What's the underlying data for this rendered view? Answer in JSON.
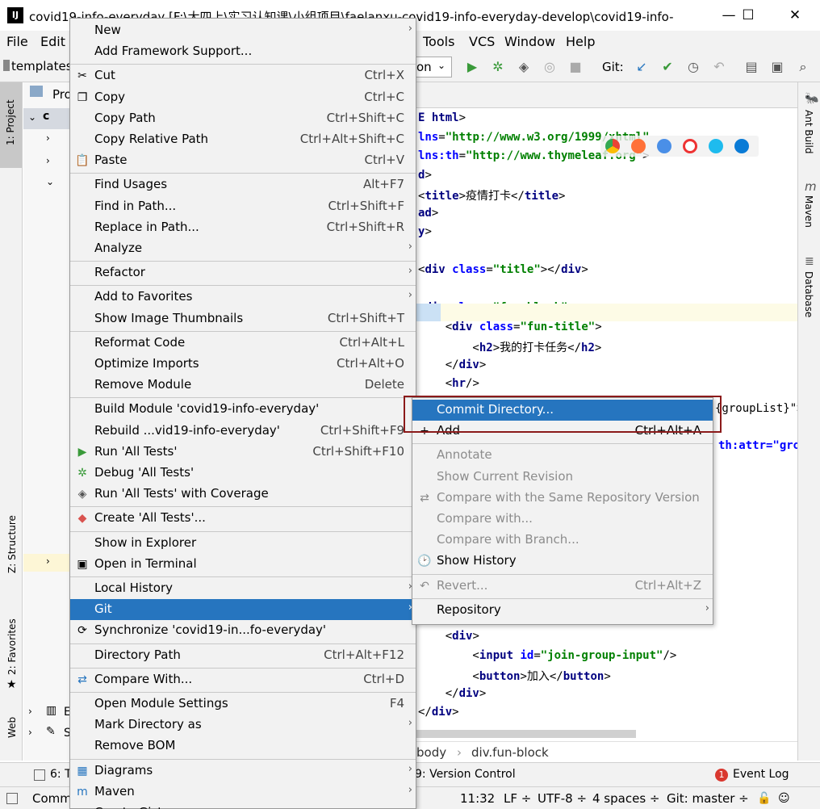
{
  "window": {
    "title": "covid19-info-everyday [F:\\大四上\\实习认知课\\小组项目\\faelanxu-covid19-info-everyday-develop\\covid19-info-...",
    "minimize": "—",
    "maximize": "☐",
    "close": "✕"
  },
  "menubar": {
    "file": "File",
    "edit": "Edit",
    "tools": "Tools",
    "vcs": "VCS",
    "window": "Window",
    "help": "Help"
  },
  "toolbar": {
    "breadcrumb": "templates",
    "run_config": "on",
    "git_label": "Git:"
  },
  "left_strip": {
    "project": "1: Project",
    "structure": "Z: Structure",
    "favorites": "2: Favorites",
    "web": "Web"
  },
  "right_strip": {
    "ant_build": "Ant Build",
    "maven": "Maven",
    "database": "Database"
  },
  "project_panel": {
    "tab": "Pro",
    "items": [
      "c",
      "E",
      "S"
    ]
  },
  "editor": {
    "lines": [
      {
        "parts": [
          [
            "tag",
            "E html"
          ],
          [
            "plain",
            ">"
          ]
        ]
      },
      {
        "parts": [
          [
            "attr",
            "lns"
          ],
          [
            "plain",
            "="
          ],
          [
            "str",
            "\"http://www.w3.org/1999/xhtml\""
          ]
        ]
      },
      {
        "parts": [
          [
            "attr",
            "lns:th"
          ],
          [
            "plain",
            "="
          ],
          [
            "str",
            "\"http://www.thymeleaf.org\""
          ],
          [
            "plain",
            ">"
          ]
        ]
      },
      {
        "parts": [
          [
            "tag",
            "d"
          ],
          [
            "plain",
            ">"
          ]
        ]
      },
      {
        "parts": [
          [
            "plain",
            "<"
          ],
          [
            "tag",
            "title"
          ],
          [
            "plain",
            ">疫情打卡</"
          ],
          [
            "tag",
            "title"
          ],
          [
            "plain",
            ">"
          ]
        ]
      },
      {
        "parts": [
          [
            "tag",
            "ad"
          ],
          [
            "plain",
            ">"
          ]
        ]
      },
      {
        "parts": [
          [
            "tag",
            "y"
          ],
          [
            "plain",
            ">"
          ]
        ]
      },
      {
        "parts": []
      },
      {
        "parts": [
          [
            "plain",
            "<"
          ],
          [
            "tag",
            "div"
          ],
          [
            "plain",
            " "
          ],
          [
            "attr",
            "class"
          ],
          [
            "plain",
            "="
          ],
          [
            "str",
            "\"title\""
          ],
          [
            "plain",
            "></"
          ],
          [
            "tag",
            "div"
          ],
          [
            "plain",
            ">"
          ]
        ]
      },
      {
        "parts": []
      },
      {
        "parts": [
          [
            "plain",
            "<"
          ],
          [
            "tag",
            "div"
          ],
          [
            "plain",
            " "
          ],
          [
            "attr",
            "class"
          ],
          [
            "plain",
            "="
          ],
          [
            "str",
            "\"fun-block\""
          ],
          [
            "plain",
            ">"
          ]
        ]
      },
      {
        "parts": [
          [
            "plain",
            "    <"
          ],
          [
            "tag",
            "div"
          ],
          [
            "plain",
            " "
          ],
          [
            "attr",
            "class"
          ],
          [
            "plain",
            "="
          ],
          [
            "str",
            "\"fun-title\""
          ],
          [
            "plain",
            ">"
          ]
        ]
      },
      {
        "parts": [
          [
            "plain",
            "        <"
          ],
          [
            "tag",
            "h2"
          ],
          [
            "plain",
            ">我的打卡任务</"
          ],
          [
            "tag",
            "h2"
          ],
          [
            "plain",
            ">"
          ]
        ]
      },
      {
        "parts": [
          [
            "plain",
            "    </"
          ],
          [
            "tag",
            "div"
          ],
          [
            "plain",
            ">"
          ]
        ]
      },
      {
        "parts": [
          [
            "plain",
            "    <"
          ],
          [
            "tag",
            "hr"
          ],
          [
            "plain",
            "/>"
          ]
        ]
      }
    ],
    "line_after_submenu_1": "{groupList}\">",
    "line_after_submenu_2": "th:attr=\"grou",
    "lines_bottom": [
      {
        "parts": [
          [
            "plain",
            "    <"
          ],
          [
            "tag",
            "div"
          ],
          [
            "plain",
            ">"
          ]
        ]
      },
      {
        "parts": [
          [
            "plain",
            "        <"
          ],
          [
            "tag",
            "input"
          ],
          [
            "plain",
            " "
          ],
          [
            "attr",
            "id"
          ],
          [
            "plain",
            "="
          ],
          [
            "str",
            "\"join-group-input\""
          ],
          [
            "plain",
            "/>"
          ]
        ]
      },
      {
        "parts": [
          [
            "plain",
            "        <"
          ],
          [
            "tag",
            "button"
          ],
          [
            "plain",
            ">加入</"
          ],
          [
            "tag",
            "button"
          ],
          [
            "plain",
            ">"
          ]
        ]
      },
      {
        "parts": [
          [
            "plain",
            "    </"
          ],
          [
            "tag",
            "div"
          ],
          [
            "plain",
            ">"
          ]
        ]
      },
      {
        "parts": [
          [
            "plain",
            "</"
          ],
          [
            "tag",
            "div"
          ],
          [
            "plain",
            ">"
          ]
        ]
      }
    ],
    "breadcrumb_1": "body",
    "breadcrumb_2": "div.fun-block"
  },
  "bottom_bar": {
    "todo": "6: T",
    "version_control": "9: Version Control",
    "event_log": "Event Log",
    "event_badge": "1"
  },
  "status_bar": {
    "left": "Comm",
    "position": "11:32",
    "line_sep": "LF ÷",
    "encoding": "UTF-8 ÷",
    "indent": "4 spaces ÷",
    "git": "Git: master ÷"
  },
  "context_menu": {
    "items": [
      {
        "label": "New",
        "shortcut": "",
        "submenu": true,
        "icon": ""
      },
      {
        "label": "Add Framework Support...",
        "shortcut": "",
        "submenu": false,
        "icon": ""
      },
      {
        "sep": true
      },
      {
        "label": "Cut",
        "shortcut": "Ctrl+X",
        "submenu": false,
        "icon": "✂"
      },
      {
        "label": "Copy",
        "shortcut": "Ctrl+C",
        "submenu": false,
        "icon": "❐"
      },
      {
        "label": "Copy Path",
        "shortcut": "Ctrl+Shift+C",
        "submenu": false,
        "icon": ""
      },
      {
        "label": "Copy Relative Path",
        "shortcut": "Ctrl+Alt+Shift+C",
        "submenu": false,
        "icon": ""
      },
      {
        "label": "Paste",
        "shortcut": "Ctrl+V",
        "submenu": false,
        "icon": "📋"
      },
      {
        "sep": true
      },
      {
        "label": "Find Usages",
        "shortcut": "Alt+F7",
        "submenu": false,
        "icon": ""
      },
      {
        "label": "Find in Path...",
        "shortcut": "Ctrl+Shift+F",
        "submenu": false,
        "icon": ""
      },
      {
        "label": "Replace in Path...",
        "shortcut": "Ctrl+Shift+R",
        "submenu": false,
        "icon": ""
      },
      {
        "label": "Analyze",
        "shortcut": "",
        "submenu": true,
        "icon": ""
      },
      {
        "sep": true
      },
      {
        "label": "Refactor",
        "shortcut": "",
        "submenu": true,
        "icon": ""
      },
      {
        "sep": true
      },
      {
        "label": "Add to Favorites",
        "shortcut": "",
        "submenu": true,
        "icon": ""
      },
      {
        "label": "Show Image Thumbnails",
        "shortcut": "Ctrl+Shift+T",
        "submenu": false,
        "icon": ""
      },
      {
        "sep": true
      },
      {
        "label": "Reformat Code",
        "shortcut": "Ctrl+Alt+L",
        "submenu": false,
        "icon": ""
      },
      {
        "label": "Optimize Imports",
        "shortcut": "Ctrl+Alt+O",
        "submenu": false,
        "icon": ""
      },
      {
        "label": "Remove Module",
        "shortcut": "Delete",
        "submenu": false,
        "icon": ""
      },
      {
        "sep": true
      },
      {
        "label": "Build Module 'covid19-info-everyday'",
        "shortcut": "",
        "submenu": false,
        "icon": ""
      },
      {
        "label": "Rebuild ...vid19-info-everyday'",
        "shortcut": "Ctrl+Shift+F9",
        "submenu": false,
        "icon": ""
      },
      {
        "label": "Run 'All Tests'",
        "shortcut": "Ctrl+Shift+F10",
        "submenu": false,
        "icon": "▶",
        "iconColor": "#3a9a3a"
      },
      {
        "label": "Debug 'All Tests'",
        "shortcut": "",
        "submenu": false,
        "icon": "✲",
        "iconColor": "#3a9a3a"
      },
      {
        "label": "Run 'All Tests' with Coverage",
        "shortcut": "",
        "submenu": false,
        "icon": "◈",
        "iconColor": "#555"
      },
      {
        "sep": true
      },
      {
        "label": "Create 'All Tests'...",
        "shortcut": "",
        "submenu": false,
        "icon": "◆",
        "iconColor": "#d9534f"
      },
      {
        "sep": true
      },
      {
        "label": "Show in Explorer",
        "shortcut": "",
        "submenu": false,
        "icon": ""
      },
      {
        "label": "Open in Terminal",
        "shortcut": "",
        "submenu": false,
        "icon": "▣"
      },
      {
        "sep": true
      },
      {
        "label": "Local History",
        "shortcut": "",
        "submenu": true,
        "icon": ""
      },
      {
        "label": "Git",
        "shortcut": "",
        "submenu": true,
        "icon": "",
        "selected": true
      },
      {
        "label": "Synchronize 'covid19-in...fo-everyday'",
        "shortcut": "",
        "submenu": false,
        "icon": "⟳"
      },
      {
        "sep": true
      },
      {
        "label": "Directory Path",
        "shortcut": "Ctrl+Alt+F12",
        "submenu": false,
        "icon": ""
      },
      {
        "sep": true
      },
      {
        "label": "Compare With...",
        "shortcut": "Ctrl+D",
        "submenu": false,
        "icon": "⇄",
        "iconColor": "#2675bf"
      },
      {
        "sep": true
      },
      {
        "label": "Open Module Settings",
        "shortcut": "F4",
        "submenu": false,
        "icon": ""
      },
      {
        "label": "Mark Directory as",
        "shortcut": "",
        "submenu": true,
        "icon": ""
      },
      {
        "label": "Remove BOM",
        "shortcut": "",
        "submenu": false,
        "icon": ""
      },
      {
        "sep": true
      },
      {
        "label": "Diagrams",
        "shortcut": "",
        "submenu": true,
        "icon": "▦",
        "iconColor": "#2675bf"
      },
      {
        "label": "Maven",
        "shortcut": "",
        "submenu": true,
        "icon": "m",
        "iconColor": "#2675bf"
      },
      {
        "label": "Create Gist...",
        "shortcut": "",
        "submenu": false,
        "icon": "●"
      }
    ]
  },
  "git_submenu": {
    "items": [
      {
        "label": "Commit Directory...",
        "shortcut": "",
        "selected": true,
        "disabled": false,
        "icon": ""
      },
      {
        "label": "Add",
        "shortcut": "Ctrl+Alt+A",
        "disabled": false,
        "icon": "+"
      },
      {
        "sep": true
      },
      {
        "label": "Annotate",
        "shortcut": "",
        "disabled": true,
        "icon": ""
      },
      {
        "label": "Show Current Revision",
        "shortcut": "",
        "disabled": true,
        "icon": ""
      },
      {
        "label": "Compare with the Same Repository Version",
        "shortcut": "",
        "disabled": true,
        "icon": "⇄"
      },
      {
        "label": "Compare with...",
        "shortcut": "",
        "disabled": true,
        "icon": ""
      },
      {
        "label": "Compare with Branch...",
        "shortcut": "",
        "disabled": true,
        "icon": ""
      },
      {
        "label": "Show History",
        "shortcut": "",
        "disabled": false,
        "icon": "🕑"
      },
      {
        "sep": true
      },
      {
        "label": "Revert...",
        "shortcut": "Ctrl+Alt+Z",
        "disabled": true,
        "icon": "↶"
      },
      {
        "sep": true
      },
      {
        "label": "Repository",
        "shortcut": "",
        "disabled": false,
        "icon": "",
        "submenu": true
      }
    ]
  }
}
